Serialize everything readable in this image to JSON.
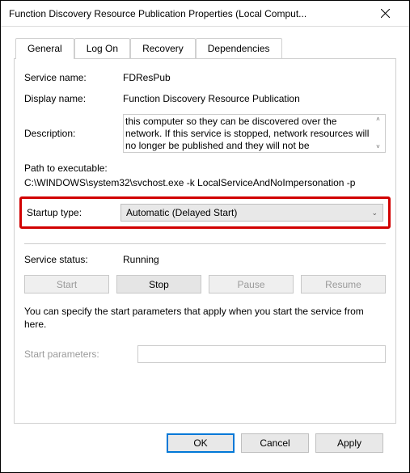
{
  "window": {
    "title": "Function Discovery Resource Publication Properties (Local Comput..."
  },
  "tabs": {
    "general": "General",
    "logon": "Log On",
    "recovery": "Recovery",
    "dependencies": "Dependencies"
  },
  "labels": {
    "service_name": "Service name:",
    "display_name": "Display name:",
    "description": "Description:",
    "path_to_exe": "Path to executable:",
    "startup_type": "Startup type:",
    "service_status": "Service status:",
    "start_parameters": "Start parameters:"
  },
  "values": {
    "service_name": "FDResPub",
    "display_name": "Function Discovery Resource Publication",
    "description": "this computer so they can be discovered over the network.  If this service is stopped, network resources will no longer be published and they will not be",
    "path": "C:\\WINDOWS\\system32\\svchost.exe -k LocalServiceAndNoImpersonation -p",
    "startup_type": "Automatic (Delayed Start)",
    "service_status": "Running",
    "note": "You can specify the start parameters that apply when you start the service from here.",
    "start_parameters": ""
  },
  "buttons": {
    "start": "Start",
    "stop": "Stop",
    "pause": "Pause",
    "resume": "Resume",
    "ok": "OK",
    "cancel": "Cancel",
    "apply": "Apply"
  }
}
